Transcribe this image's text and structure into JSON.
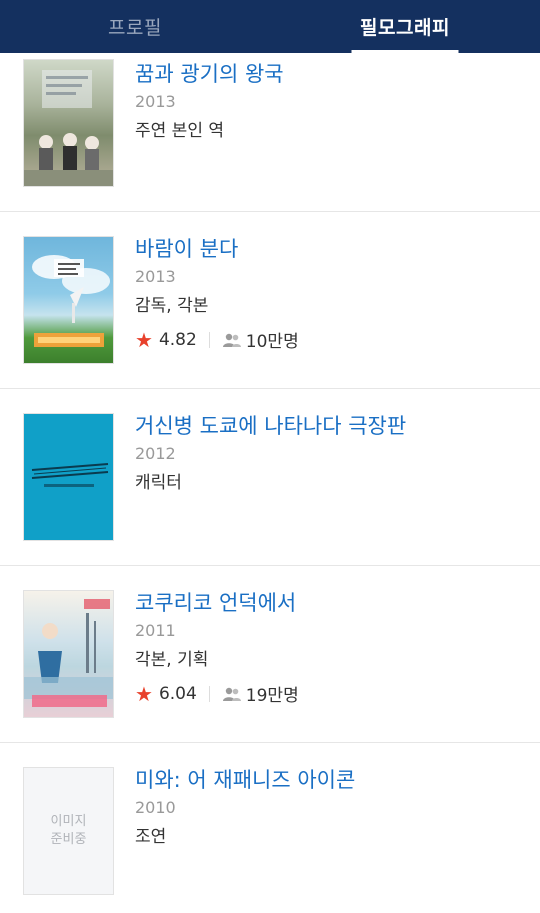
{
  "tabs": [
    {
      "label": "프로필",
      "active": false
    },
    {
      "label": "필모그래피",
      "active": true
    }
  ],
  "films": [
    {
      "title": "꿈과 광기의 왕국",
      "year": "2013",
      "role": "주연 본인 역"
    },
    {
      "title": "바람이 분다",
      "year": "2013",
      "role": "감독, 각본",
      "rating": "4.82",
      "audience": "10만명"
    },
    {
      "title": "거신병 도쿄에 나타나다 극장판",
      "year": "2012",
      "role": "캐릭터"
    },
    {
      "title": "코쿠리코 언덕에서",
      "year": "2011",
      "role": "각본, 기획",
      "rating": "6.04",
      "audience": "19만명"
    },
    {
      "title": "미와: 어 재패니즈 아이콘",
      "year": "2010",
      "role": "조연"
    }
  ],
  "placeholder": {
    "line1": "이미지",
    "line2": "준비중"
  },
  "icons": {
    "rating": "star-icon",
    "audience": "people-icon"
  },
  "colors": {
    "header": "#14305f",
    "title_link": "#1a6fc4",
    "star": "#e8412c"
  }
}
